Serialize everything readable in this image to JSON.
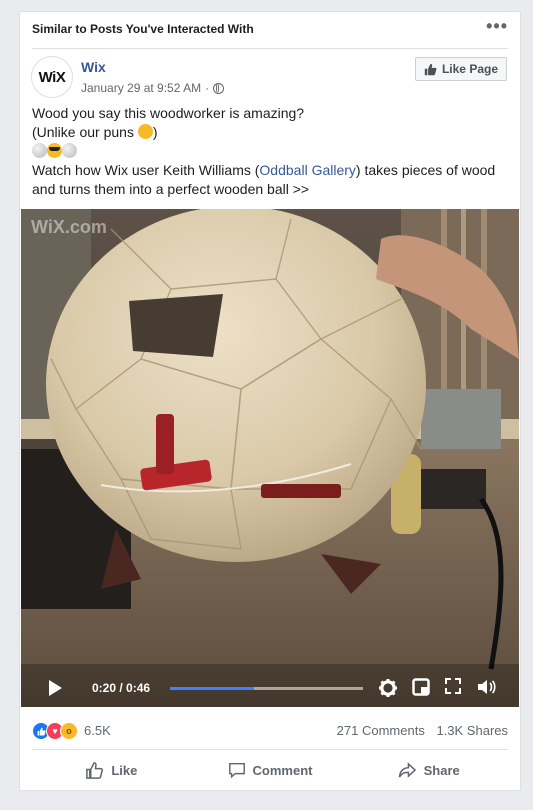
{
  "header": {
    "context_label": "Similar to Posts You've Interacted With",
    "more_icon": "more-horizontal-icon"
  },
  "page": {
    "avatar_text": "WiX",
    "name": "Wix",
    "timestamp": "January 29 at 9:52 AM",
    "separator": "·",
    "privacy_icon": "globe-icon",
    "like_page_label": "Like Page"
  },
  "post": {
    "line1": "Wood you say this woodworker is amazing?",
    "line2_prefix": "(Unlike our puns",
    "line2_suffix": ")",
    "line4_prefix": "Watch how Wix user Keith Williams (",
    "line4_link": "Oddball Gallery",
    "line4_suffix": ") takes pieces of wood",
    "line5": "and turns them into a perfect wooden ball >>"
  },
  "video": {
    "watermark": "WiX.com",
    "time_label": "0:20 / 0:46",
    "progress": 0.435,
    "accent": "#4080ff"
  },
  "stats": {
    "reactions_count": "6.5K",
    "comments": "271 Comments",
    "shares": "1.3K Shares"
  },
  "actions": {
    "like": "Like",
    "comment": "Comment",
    "share": "Share"
  }
}
